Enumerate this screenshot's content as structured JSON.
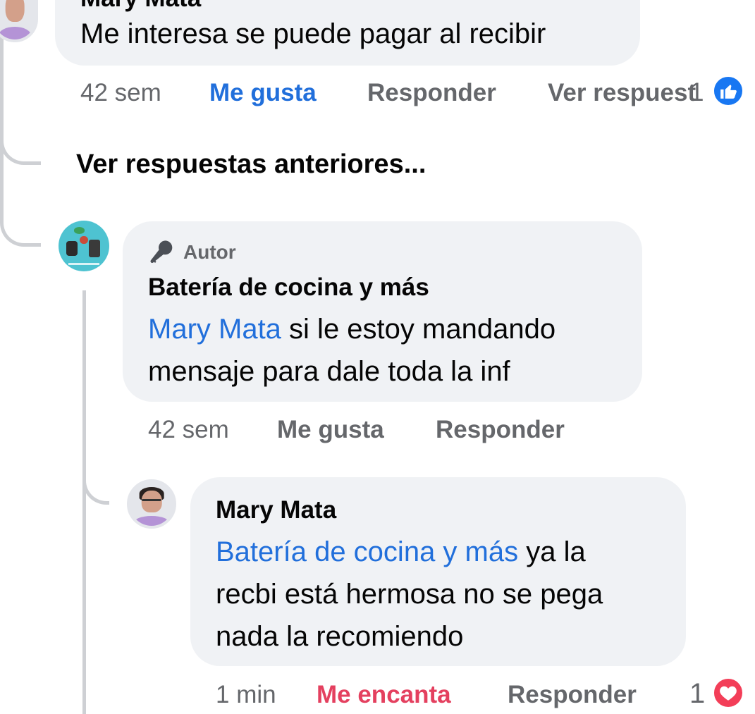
{
  "comment_top": {
    "author_partial": "Mary Mata",
    "text": "Me interesa se puede pagar al recibir",
    "time": "42 sem",
    "like_label": "Me gusta",
    "reply_label": "Responder",
    "view_replies_label": "Ver respuest",
    "reaction_count": "1",
    "reaction_icon": "like-icon"
  },
  "view_previous_label": "Ver respuestas anteriores...",
  "reply_page": {
    "badge_label": "Autor",
    "author": "Batería de cocina y más",
    "mention": "Mary Mata",
    "text_line1_rest": " si le estoy mandando",
    "text_line2": "mensaje para dale toda la inf",
    "time": "42 sem",
    "like_label": "Me gusta",
    "reply_label": "Responder"
  },
  "reply_mary": {
    "author": "Mary Mata",
    "mention": "Batería de cocina y más",
    "text_line1_rest": " ya la",
    "text_line2": "recbi está hermosa no se pega",
    "text_line3": "nada la recomiendo",
    "time": "1 min",
    "reaction_label": "Me encanta",
    "reply_label": "Responder",
    "reaction_count": "1",
    "reaction_icon": "heart-icon"
  },
  "colors": {
    "accent": "#216fdb",
    "love": "#e4405f",
    "bubble": "#f0f2f5",
    "meta": "#65676b"
  }
}
